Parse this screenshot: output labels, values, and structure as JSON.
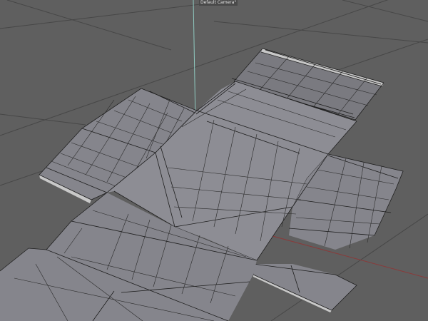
{
  "viewport": {
    "camera_label": "Default Camera",
    "camera_marker": "°",
    "colors": {
      "background": "#5f5f5f",
      "floor_grid": "#474747",
      "mesh_face": "#85858c",
      "wireframe": "#1e1e1e",
      "y_axis": "#8fc9c0",
      "x_axis": "#8a3a3a"
    },
    "icons": [
      "camera-marker-icon"
    ]
  }
}
